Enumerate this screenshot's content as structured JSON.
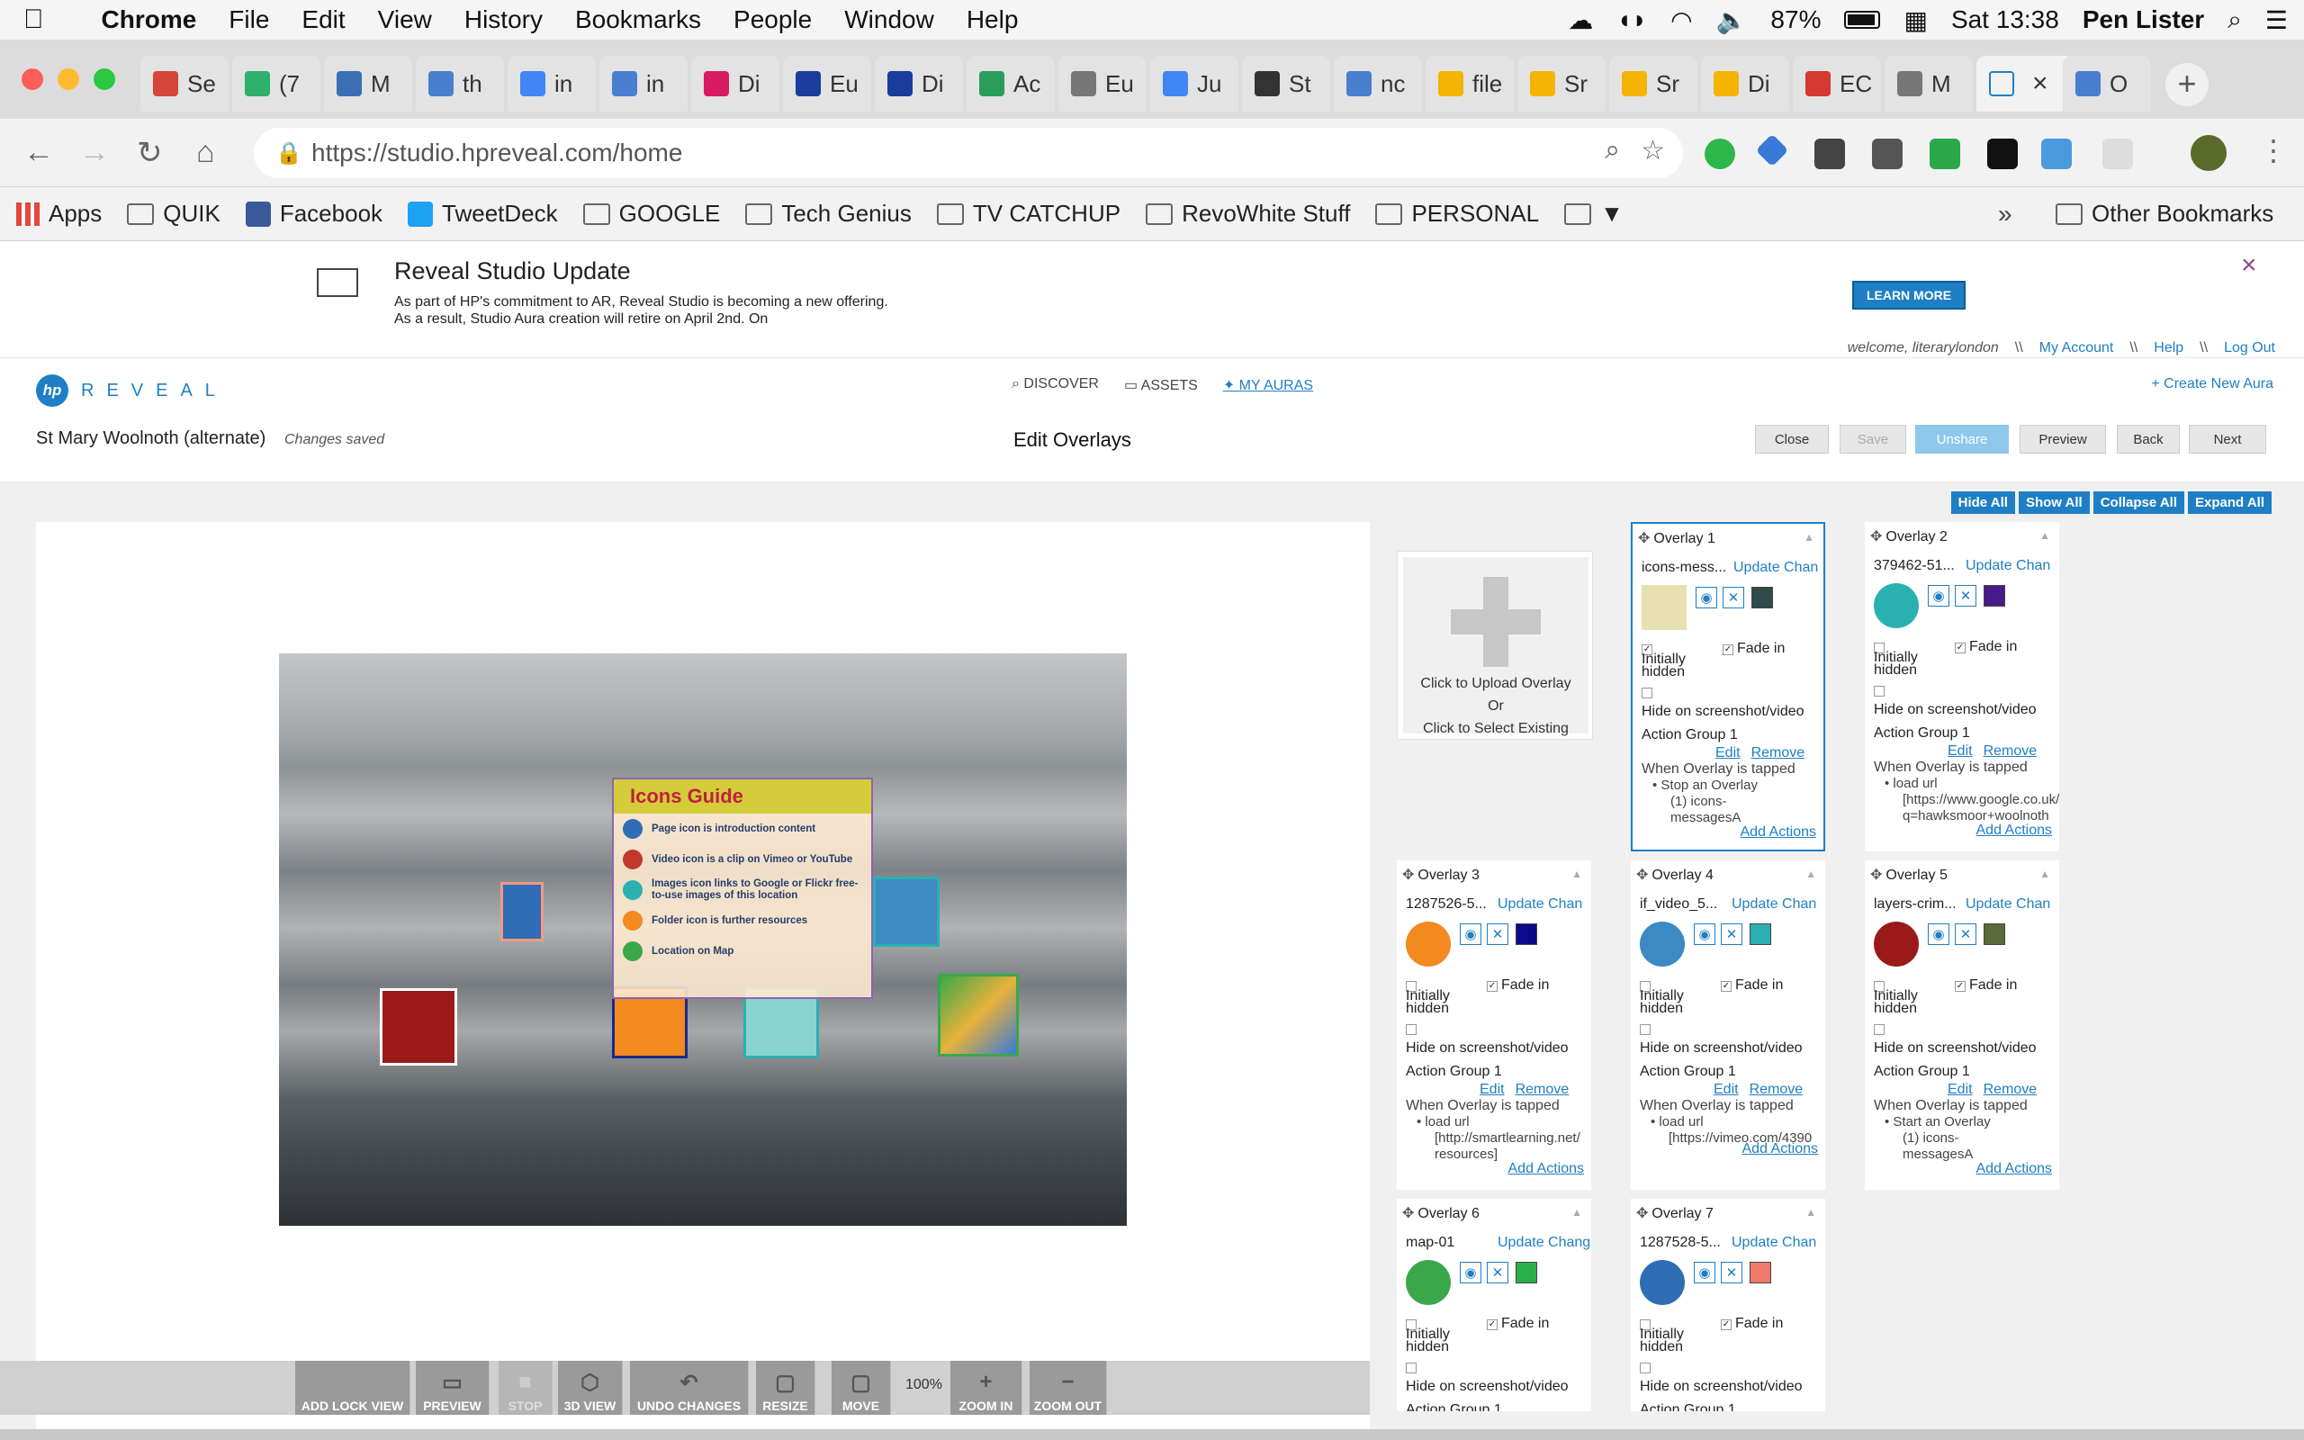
{
  "macbar": {
    "app": "Chrome",
    "menus": [
      "File",
      "Edit",
      "View",
      "History",
      "Bookmarks",
      "People",
      "Window",
      "Help"
    ],
    "battery": "87%",
    "clock": "Sat 13:38",
    "user": "Pen Lister"
  },
  "tabs": [
    {
      "label": "Se",
      "color": "#d44638"
    },
    {
      "label": "(7",
      "color": "#2fb06a"
    },
    {
      "label": "M",
      "color": "#3b6fb3"
    },
    {
      "label": "th",
      "color": "#4a7fd0"
    },
    {
      "label": "in",
      "color": "#4285f4"
    },
    {
      "label": "in",
      "color": "#4a7fd0"
    },
    {
      "label": "Di",
      "color": "#d81b60"
    },
    {
      "label": "Eu",
      "color": "#1a3c9c"
    },
    {
      "label": "Di",
      "color": "#1a3c9c"
    },
    {
      "label": "Ac",
      "color": "#2a9d5a"
    },
    {
      "label": "Eu",
      "color": "#777777"
    },
    {
      "label": "Ju",
      "color": "#4285f4"
    },
    {
      "label": "St",
      "color": "#333333"
    },
    {
      "label": "nc",
      "color": "#4a7fd0"
    },
    {
      "label": "file",
      "color": "#f4b400"
    },
    {
      "label": "Sr",
      "color": "#f4b400"
    },
    {
      "label": "Sr",
      "color": "#f4b400"
    },
    {
      "label": "Di",
      "color": "#f4b400"
    },
    {
      "label": "EC",
      "color": "#d43a2f"
    },
    {
      "label": "M",
      "color": "#777777"
    }
  ],
  "active_tab": {
    "label": "",
    "close": "×"
  },
  "last_tab": {
    "label": "O",
    "color": "#4a7fd0"
  },
  "omnibar": {
    "url": "https://studio.hpreveal.com/home"
  },
  "bookmarks": [
    {
      "label": "Apps",
      "icon": "apps-grid-icon"
    },
    {
      "label": "QUIK",
      "icon": "folder-icon"
    },
    {
      "label": "Facebook",
      "icon": "facebook-icon"
    },
    {
      "label": "TweetDeck",
      "icon": "tweetdeck-icon"
    },
    {
      "label": "GOOGLE",
      "icon": "folder-icon"
    },
    {
      "label": "Tech Genius",
      "icon": "folder-icon"
    },
    {
      "label": "TV CATCHUP",
      "icon": "folder-icon"
    },
    {
      "label": "RevoWhite Stuff",
      "icon": "folder-icon"
    },
    {
      "label": "PERSONAL",
      "icon": "folder-icon"
    },
    {
      "label": "▼",
      "icon": "folder-icon"
    }
  ],
  "bookmarks_more": "»",
  "other_bookmarks": "Other Bookmarks",
  "banner": {
    "title": "Reveal Studio Update",
    "text": "As part of HP's commitment to AR, Reveal Studio is becoming a new offering. As a result, Studio Aura creation will retire on April 2nd. On",
    "learn_more": "LEARN MORE",
    "close": "×"
  },
  "usernav": {
    "welcome": "welcome, literarylondon",
    "sep": "\\\\",
    "account": "My Account",
    "help": "Help",
    "logout": "Log Out"
  },
  "logo": {
    "hp": "hp",
    "text": "REVEAL"
  },
  "mainnav": {
    "discover": "DISCOVER",
    "assets": "ASSETS",
    "my_auras": "MY AURAS",
    "create": "+ Create New Aura"
  },
  "titlebar": {
    "aura_name": "St Mary Woolnoth (alternate)",
    "status": "Changes saved",
    "title": "Edit Overlays",
    "buttons": {
      "close": "Close",
      "save": "Save",
      "unshare": "Unshare",
      "preview": "Preview",
      "back": "Back",
      "next": "Next"
    }
  },
  "panel_buttons": {
    "hide_all": "Hide All",
    "show_all": "Show All",
    "collapse_all": "Collapse All",
    "expand_all": "Expand All"
  },
  "upload": {
    "line1": "Click to Upload Overlay",
    "line2": "Or",
    "line3": "Click to Select Existing"
  },
  "icons_guide": {
    "title": "Icons Guide",
    "items": [
      {
        "text": "Page icon is introduction content",
        "color": "#2f6db5"
      },
      {
        "text": "Video icon is a clip on Vimeo or YouTube",
        "color": "#c0392b"
      },
      {
        "text": "Images icon links to Google or Flickr free-to-use images of this location",
        "color": "#2ab0b0"
      },
      {
        "text": "Folder icon is further resources",
        "color": "#f28a20"
      },
      {
        "text": "Location on Map",
        "color": "#3aa84a"
      }
    ]
  },
  "toolbar": {
    "add_lock_view": "ADD LOCK VIEW",
    "preview": "PREVIEW",
    "stop": "STOP",
    "view_3d": "3D VIEW",
    "undo": "UNDO CHANGES",
    "resize": "RESIZE",
    "move": "MOVE",
    "zoom": "100%",
    "zoom_in": "ZOOM IN",
    "zoom_out": "ZOOM OUT"
  },
  "card_labels": {
    "fade_in": "Fade in",
    "initially_hidden": "Initially hidden",
    "hide_on": "Hide on screenshot/video",
    "action_group": "Action Group 1",
    "edit": "Edit",
    "remove": "Remove",
    "when_tapped": "When Overlay is tapped",
    "add_actions": "Add Actions"
  },
  "overlays": [
    {
      "title": "Overlay 1",
      "name": "icons-mess...",
      "update": "Update Chan",
      "swatch": "#2e4a4a",
      "thumb": "#e8e0b0",
      "action1": "Stop an Overlay",
      "action2": "(1) icons-",
      "action3": "messagesA",
      "selected": true
    },
    {
      "title": "Overlay 2",
      "name": "379462-51...",
      "update": "Update Chan",
      "swatch": "#4a1a8a",
      "thumb": "#2ab0b0",
      "action1": "load url",
      "action2": "[https://www.google.co.uk/",
      "action3": "q=hawksmoor+woolnoth"
    },
    {
      "title": "Overlay 3",
      "name": "1287526-5...",
      "update": "Update Chan",
      "swatch": "#0a0a8a",
      "thumb": "#f28a20",
      "action1": "load url",
      "action2": "[http://smartlearning.net/",
      "action3": "resources]"
    },
    {
      "title": "Overlay 4",
      "name": "if_video_5...",
      "update": "Update Chan",
      "swatch": "#2ab0b0",
      "thumb": "#3b8ac4",
      "action1": "load url",
      "action2": "[https://vimeo.com/4390",
      "action3": ""
    },
    {
      "title": "Overlay 5",
      "name": "layers-crim...",
      "update": "Update Chan",
      "swatch": "#5a6a3a",
      "thumb": "#9a1a1a",
      "action1": "Start an Overlay",
      "action2": "(1) icons-",
      "action3": "messagesA"
    },
    {
      "title": "Overlay 6",
      "name": "map-01",
      "update": "Update Change",
      "swatch": "#2ab04a",
      "thumb": "#3aa84a"
    },
    {
      "title": "Overlay 7",
      "name": "1287528-5...",
      "update": "Update Chan",
      "swatch": "#f07a6a",
      "thumb": "#2f6db5"
    }
  ]
}
